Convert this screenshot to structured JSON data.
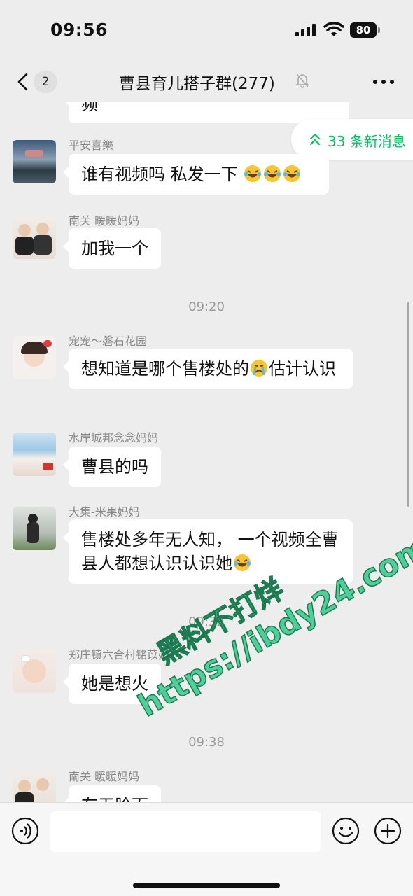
{
  "status_bar": {
    "time": "09:56",
    "battery": "80"
  },
  "header": {
    "back_count": "2",
    "title": "曹县育儿搭子群(277)"
  },
  "new_messages": {
    "label": "33 条新消息"
  },
  "partial_top_text": "频",
  "messages": [
    {
      "sender": "平安喜樂",
      "text": "谁有视频吗 私发一下",
      "emojis": [
        "laugh-cry",
        "laugh-cry",
        "laugh-cry"
      ]
    },
    {
      "sender": "南关 暖暖妈妈",
      "text": "加我一个"
    },
    {
      "sender": "宠宠～磐石花园",
      "text_before": "想知道是哪个售楼处的",
      "emoji": "cry",
      "text_after": "估计认识"
    },
    {
      "sender": "水岸城邦念念妈妈",
      "text": "曹县的吗"
    },
    {
      "sender": "大集-米果妈妈",
      "text": "售楼处多年无人知， 一个视频全曹县人都想认识认识她",
      "emoji": "laugh-cry"
    },
    {
      "sender": "郑庄镇六合村铭苡妈妈",
      "text": "她是想火"
    },
    {
      "sender": "南关 暖暖妈妈",
      "text": "有无脸面"
    }
  ],
  "timestamps": [
    "09:20",
    "09:32",
    "09:38"
  ],
  "watermark": {
    "line1": "黑料不打烊",
    "line2": "https://ibdy24.com"
  },
  "colors": {
    "accent": "#07c160",
    "background": "#ededed",
    "bubble": "#ffffff"
  },
  "icons": [
    "back-chevron-icon",
    "mute-bell-icon",
    "more-icon",
    "double-chevron-up-icon",
    "voice-icon",
    "emoji-icon",
    "plus-icon"
  ]
}
